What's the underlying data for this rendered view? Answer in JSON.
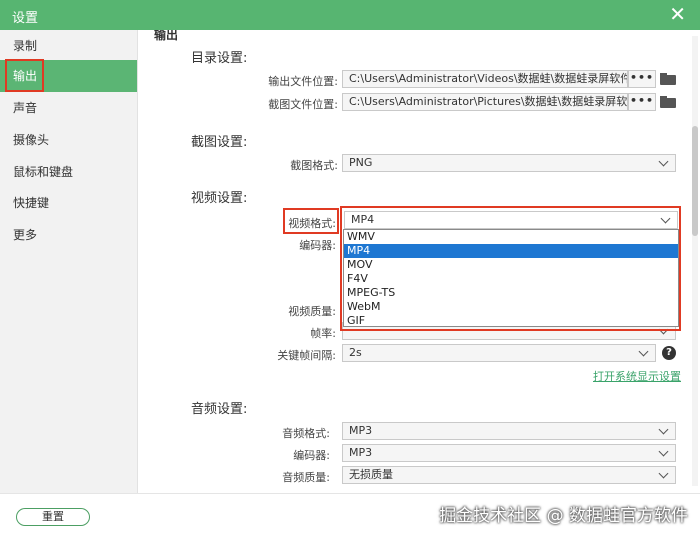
{
  "window": {
    "title": "设置",
    "close_symbol": "✕"
  },
  "sidebar": {
    "items": [
      {
        "label": "录制"
      },
      {
        "label": "输出"
      },
      {
        "label": "声音"
      },
      {
        "label": "摄像头"
      },
      {
        "label": "鼠标和键盘"
      },
      {
        "label": "快捷键"
      },
      {
        "label": "更多"
      }
    ],
    "active": "输出"
  },
  "content": {
    "header": "输出",
    "directory": {
      "title": "目录设置:",
      "output_label": "输出文件位置:",
      "output_path": "C:\\Users\\Administrator\\Videos\\数据蛙\\数据蛙录屏软件",
      "screenshot_label": "截图文件位置:",
      "screenshot_path": "C:\\Users\\Administrator\\Pictures\\数据蛙\\数据蛙录屏软件",
      "browse_label": "•••"
    },
    "screenshot": {
      "title": "截图设置:",
      "format_label": "截图格式:",
      "format_value": "PNG"
    },
    "video": {
      "title": "视频设置:",
      "format_label": "视频格式:",
      "format_value": "MP4",
      "format_options": [
        "WMV",
        "MP4",
        "MOV",
        "F4V",
        "MPEG-TS",
        "WebM",
        "GIF"
      ],
      "encoder_label": "编码器:",
      "quality_label": "视频质量:",
      "framerate_label": "帧率:",
      "keyframe_label": "关键帧间隔:",
      "keyframe_value": "2s",
      "help_symbol": "?",
      "display_link": "打开系统显示设置"
    },
    "audio": {
      "title": "音频设置:",
      "format_label": "音频格式:",
      "format_value": "MP3",
      "encoder_label": "编码器:",
      "encoder_value": "MP3",
      "quality_label": "音频质量:",
      "quality_value": "无损质量"
    }
  },
  "footer": {
    "reset_label": "重置",
    "watermark": "掘金技术社区 @ 数据蛙官方软件"
  },
  "colors": {
    "accent": "#57b571",
    "highlight_box": "#e03a23",
    "selection": "#1e77d2",
    "link": "#3aa36a"
  }
}
